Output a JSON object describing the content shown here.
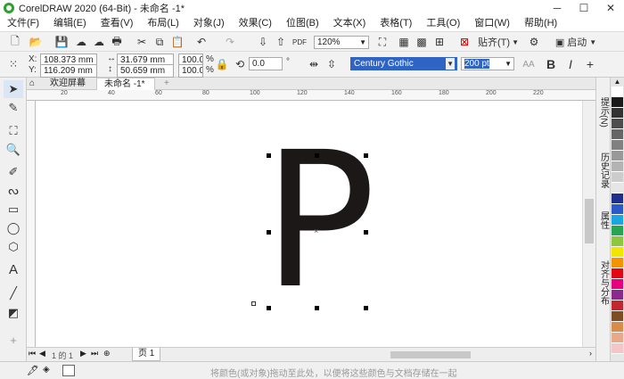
{
  "window": {
    "title": "CorelDRAW 2020 (64-Bit) - 未命名 -1*",
    "minimize": "─",
    "maximize": "☐",
    "close": "✕"
  },
  "menu": [
    "文件(F)",
    "编辑(E)",
    "查看(V)",
    "布局(L)",
    "对象(J)",
    "效果(C)",
    "位图(B)",
    "文本(X)",
    "表格(T)",
    "工具(O)",
    "窗口(W)",
    "帮助(H)"
  ],
  "toolbar": {
    "zoom": "120%",
    "snap_label": "贴齐(T)",
    "launch_label": "启动"
  },
  "properties": {
    "x_label": "X:",
    "x_value": "108.373 mm",
    "y_label": "Y:",
    "y_value": "116.209 mm",
    "width_value": "31.679 mm",
    "height_value": "50.659 mm",
    "scale_x": "100.0",
    "scale_y": "100.0",
    "percent": "%",
    "rotation": "0.0",
    "degree": "°",
    "font_name": "Century Gothic",
    "font_size": "200 pt"
  },
  "tabs": {
    "welcome": "欢迎屏幕",
    "document": "未命名 -1*",
    "add": "+"
  },
  "ruler_ticks": [
    "20",
    "40",
    "60",
    "80",
    "100",
    "120",
    "140",
    "160",
    "180",
    "200",
    "220"
  ],
  "canvas": {
    "letter": "P"
  },
  "page_nav": {
    "counter": "1 的 1",
    "page_tab": "页 1"
  },
  "status": {
    "hint": "将颜色(或对象)拖动至此处，以便将这些颜色与文档存储在一起"
  },
  "dockers": [
    "提示(N)",
    "历史记录",
    "属性",
    "对齐与分布"
  ],
  "palette": [
    "#ffffff",
    "#1a1a1a",
    "#333333",
    "#4d4d4d",
    "#666666",
    "#808080",
    "#999999",
    "#b3b3b3",
    "#cccccc",
    "#e6e6e6",
    "#1f2f8f",
    "#2a59c8",
    "#1aa6e0",
    "#26a552",
    "#8dc63f",
    "#f2e600",
    "#f29400",
    "#e30613",
    "#e6007e",
    "#8a2a8a",
    "#c1272d",
    "#7d4e24",
    "#d98c4a",
    "#e8a88a",
    "#f4c6c6"
  ]
}
